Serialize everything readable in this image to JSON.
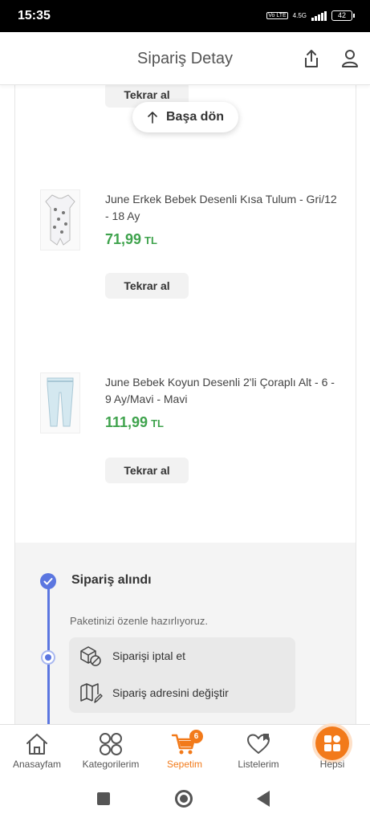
{
  "status_bar": {
    "time": "15:35",
    "volte": "Vo LTE",
    "network": "4.5G",
    "battery": "42"
  },
  "header": {
    "title": "Sipariş Detay",
    "icons": [
      "share-icon",
      "user-icon"
    ]
  },
  "back_to_top": {
    "label": "Başa dön"
  },
  "products": [
    {
      "reorder_label": "Tekrar al"
    },
    {
      "name": "June Erkek Bebek Desenli Kısa Tulum - Gri/12 - 18 Ay",
      "price": "71,99",
      "currency": "TL",
      "reorder_label": "Tekrar al"
    },
    {
      "name": "June Bebek Koyun Desenli 2'li Çoraplı Alt - 6 - 9 Ay/Mavi - Mavi",
      "price": "111,99",
      "currency": "TL",
      "reorder_label": "Tekrar al"
    }
  ],
  "timeline": {
    "status_title": "Sipariş alındı",
    "status_sub": "Paketinizi özenle hazırlıyoruz.",
    "actions": [
      {
        "label": "Siparişi iptal et",
        "icon": "cancel-box-icon"
      },
      {
        "label": "Sipariş adresini değiştir",
        "icon": "map-edit-icon"
      }
    ]
  },
  "tabbar": {
    "items": [
      {
        "label": "Anasayfam",
        "icon": "home-icon"
      },
      {
        "label": "Kategorilerim",
        "icon": "categories-icon"
      },
      {
        "label": "Sepetim",
        "icon": "cart-icon",
        "badge": "6",
        "active": true
      },
      {
        "label": "Listelerim",
        "icon": "heart-list-icon"
      },
      {
        "label": "Hepsi",
        "icon": "hepsi-icon"
      }
    ]
  },
  "colors": {
    "accent": "#f27a1a",
    "price_green": "#3fa34d",
    "timeline_blue": "#5b76e0"
  }
}
